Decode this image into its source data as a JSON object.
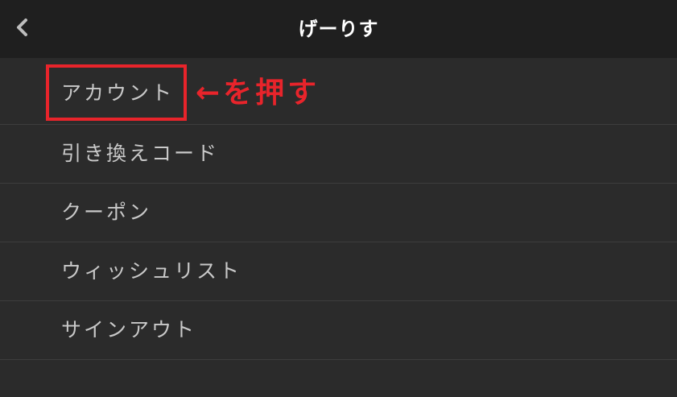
{
  "header": {
    "title": "げーりす",
    "back_icon": "chevron-left-icon"
  },
  "menu": {
    "items": [
      {
        "label": "アカウント"
      },
      {
        "label": "引き換えコード"
      },
      {
        "label": "クーポン"
      },
      {
        "label": "ウィッシュリスト"
      },
      {
        "label": "サインアウト"
      }
    ]
  },
  "annotation": {
    "text": "←を押す",
    "color": "#e8242b"
  },
  "colors": {
    "background": "#2b2b2b",
    "header_background": "#1f1f1f",
    "menu_text": "#c9c9c9",
    "divider": "#3d3d3d",
    "highlight": "#e8242b"
  }
}
